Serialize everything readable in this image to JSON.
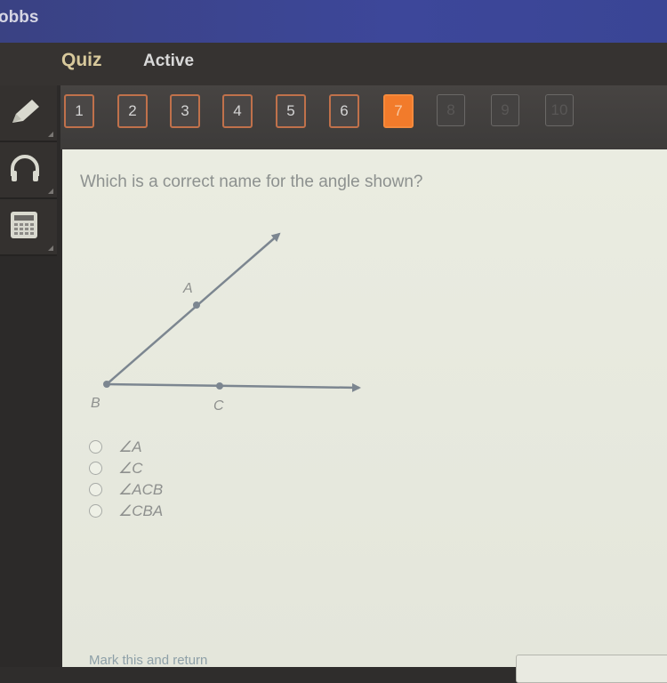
{
  "titlebar": {
    "user_name_fragment": "obbs"
  },
  "quizbar": {
    "title": "Quiz",
    "status": "Active"
  },
  "navigation": {
    "questions": [
      {
        "label": "1",
        "state": "answered"
      },
      {
        "label": "2",
        "state": "answered"
      },
      {
        "label": "3",
        "state": "answered"
      },
      {
        "label": "4",
        "state": "answered"
      },
      {
        "label": "5",
        "state": "answered"
      },
      {
        "label": "6",
        "state": "answered"
      },
      {
        "label": "7",
        "state": "current"
      },
      {
        "label": "8",
        "state": "disabled"
      },
      {
        "label": "9",
        "state": "disabled"
      },
      {
        "label": "10",
        "state": "disabled"
      }
    ],
    "current_color": "#f27b2b"
  },
  "tools": [
    {
      "icon": "pencil-icon"
    },
    {
      "icon": "headphones-icon"
    },
    {
      "icon": "calculator-icon"
    }
  ],
  "question": {
    "prompt": "Which is a correct name for the angle shown?",
    "figure": {
      "points": [
        {
          "label": "A",
          "on": "ray BA"
        },
        {
          "label": "B",
          "on": "vertex"
        },
        {
          "label": "C",
          "on": "ray BC"
        }
      ],
      "vertex": "B",
      "rays": [
        "BA",
        "BC"
      ]
    },
    "options": [
      {
        "label": "∠A"
      },
      {
        "label": "∠C"
      },
      {
        "label": "∠ACB"
      },
      {
        "label": "∠CBA"
      }
    ]
  },
  "footer": {
    "mark_label": "Mark this and return"
  }
}
